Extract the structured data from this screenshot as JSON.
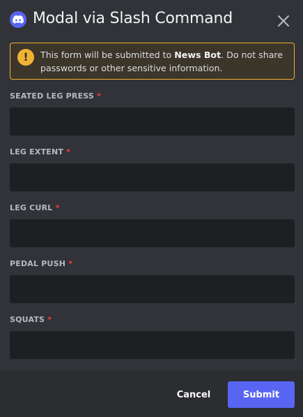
{
  "modal": {
    "title": "Modal via Slash Command",
    "app_icon": "discord-logo-icon",
    "close_icon": "close-icon"
  },
  "notice": {
    "icon": "warning-icon",
    "text_before": "This form will be submitted to ",
    "bot_name": "News Bot",
    "text_after": ". Do not share passwords or other sensitive information."
  },
  "fields": [
    {
      "label": "SEATED LEG PRESS",
      "required_mark": "*",
      "value": "",
      "placeholder": ""
    },
    {
      "label": "LEG EXTENT",
      "required_mark": "*",
      "value": "",
      "placeholder": ""
    },
    {
      "label": "LEG CURL",
      "required_mark": "*",
      "value": "",
      "placeholder": ""
    },
    {
      "label": "PEDAL PUSH",
      "required_mark": "*",
      "value": "",
      "placeholder": ""
    },
    {
      "label": "SQUATS",
      "required_mark": "*",
      "value": "",
      "placeholder": ""
    }
  ],
  "footer": {
    "cancel_label": "Cancel",
    "submit_label": "Submit"
  },
  "colors": {
    "background": "#313338",
    "footer": "#2b2d31",
    "input": "#1e1f22",
    "accent": "#5865f2",
    "warning": "#f0b232",
    "required": "#f23f42"
  }
}
